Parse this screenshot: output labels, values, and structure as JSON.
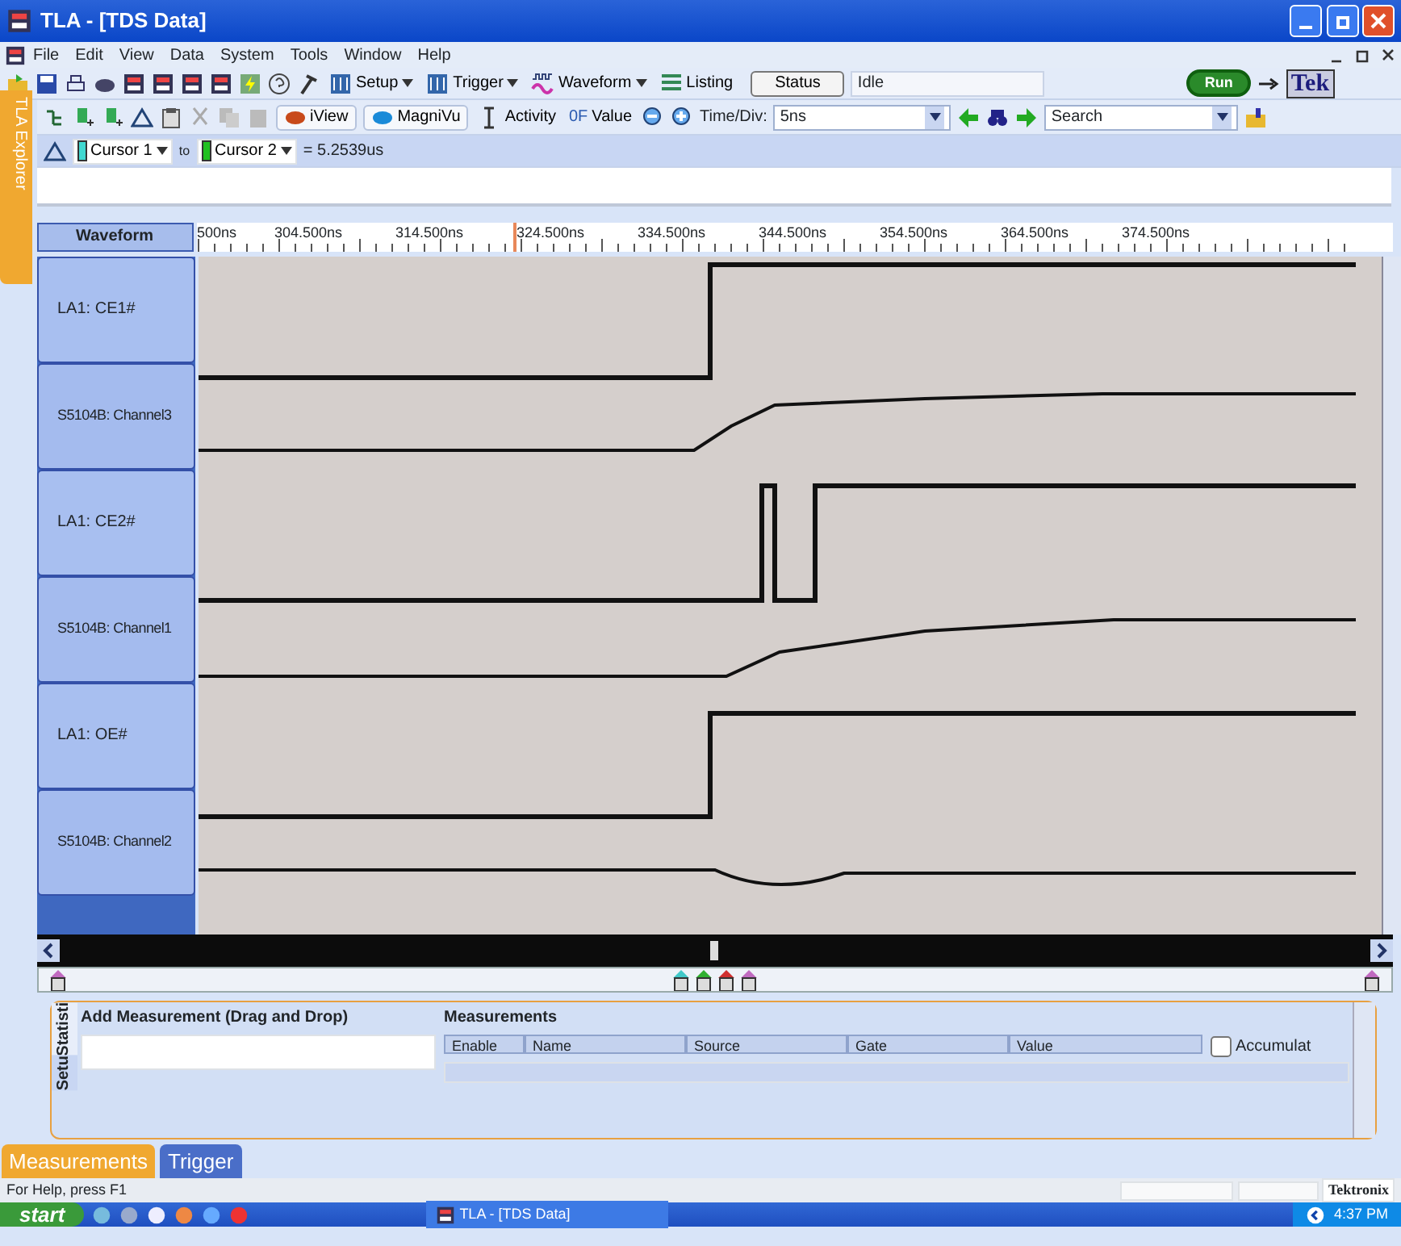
{
  "window": {
    "title": "TLA - [TDS Data]"
  },
  "menu": [
    "File",
    "Edit",
    "View",
    "Data",
    "System",
    "Tools",
    "Window",
    "Help"
  ],
  "toolbar": {
    "setup": "Setup",
    "trigger": "Trigger",
    "waveform": "Waveform",
    "listing": "Listing",
    "status_button": "Status",
    "status_value": "Idle",
    "run": "Run",
    "brand": "Tek"
  },
  "view_toolbar": {
    "modes": [
      {
        "label": "iView",
        "kind": "pill"
      },
      {
        "label": "MagniVu",
        "kind": "pill"
      },
      {
        "label": "Activity",
        "kind": "bar"
      },
      {
        "label": "Value",
        "kind": "hex",
        "prefix": "0F"
      }
    ],
    "time_div_label": "Time/Div:",
    "time_div": "5ns",
    "search": "Search"
  },
  "cursor_bar": {
    "from": "Cursor 1",
    "to_label": "to",
    "to": "Cursor 2",
    "delta": "= 5.2539us"
  },
  "explorer_tab": "TLA Explorer",
  "waveform": {
    "header": "Waveform",
    "ticks": [
      "500ns",
      "304.500ns",
      "314.500ns",
      "324.500ns",
      "334.500ns",
      "344.500ns",
      "354.500ns",
      "364.500ns",
      "374.500ns"
    ],
    "rows": [
      {
        "label": "LA1: CE1#",
        "kind": "digital"
      },
      {
        "label": "S5104B: Channel3",
        "kind": "analog"
      },
      {
        "label": "LA1: CE2#",
        "kind": "digital"
      },
      {
        "label": "S5104B: Channel1",
        "kind": "analog"
      },
      {
        "label": "LA1: OE#",
        "kind": "digital"
      },
      {
        "label": "S5104B: Channel2",
        "kind": "analog"
      }
    ]
  },
  "bottom_panel": {
    "side_tabs": [
      "Statisti",
      "Setu"
    ],
    "add_title": "Add Measurement (Drag and Drop)",
    "measure_title": "Measurements",
    "columns": [
      "Enable",
      "Name",
      "Source",
      "Gate",
      "Value"
    ],
    "accumulate": {
      "label": "Accumulat",
      "checked": false
    }
  },
  "tabs": [
    {
      "label": "Measurements",
      "selected": true
    },
    {
      "label": "Trigger",
      "selected": false
    }
  ],
  "status_bar": {
    "help": "For Help, press F1",
    "brand": "Tektronix"
  },
  "taskbar": {
    "start": "start",
    "task": "TLA - [TDS Data]",
    "clock": "4:37 PM"
  }
}
